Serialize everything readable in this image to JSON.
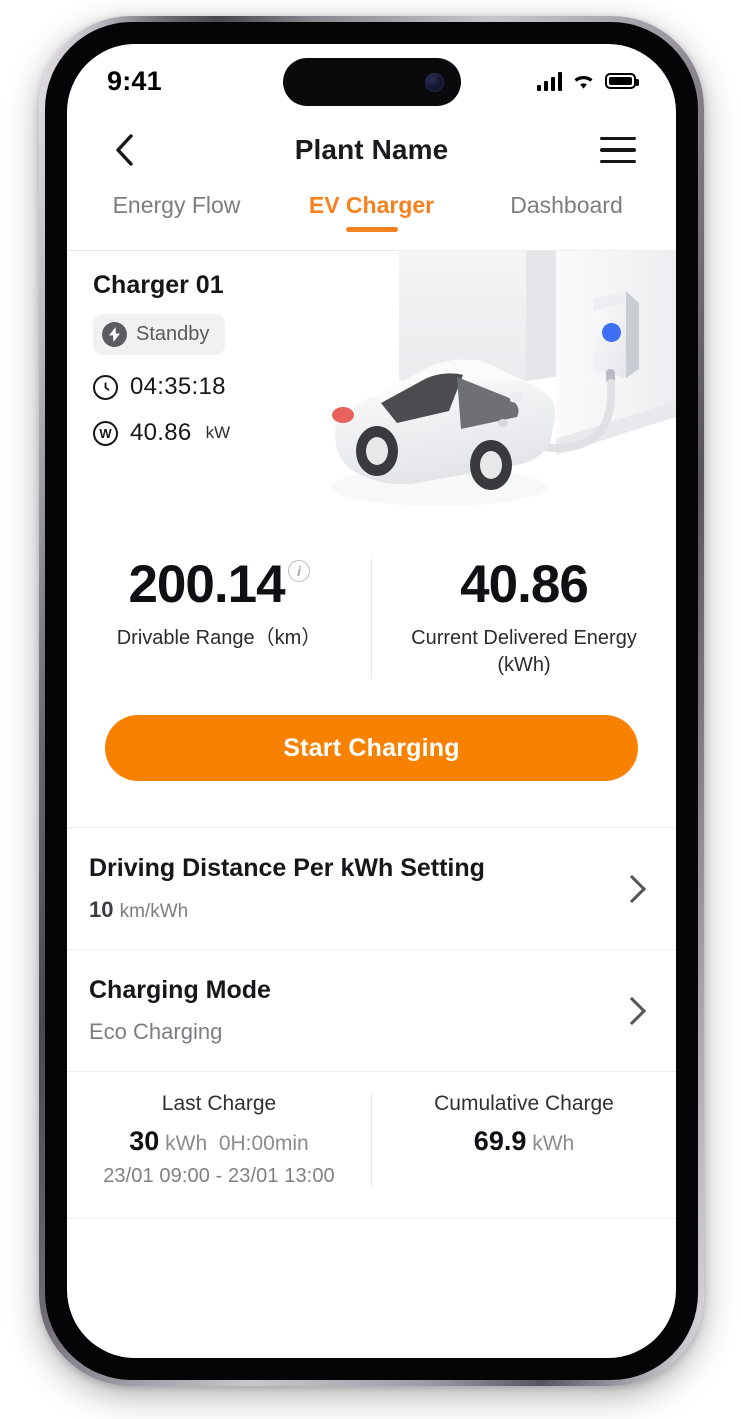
{
  "status_bar": {
    "time": "9:41",
    "signal_icon": "cellular-bars-icon",
    "wifi_icon": "wifi-icon",
    "battery_icon": "battery-full-icon"
  },
  "nav": {
    "back_icon": "chevron-left-icon",
    "title": "Plant Name",
    "menu_icon": "hamburger-menu-icon"
  },
  "tabs": [
    {
      "label": "Energy Flow",
      "active": false
    },
    {
      "label": "EV Charger",
      "active": true
    },
    {
      "label": "Dashboard",
      "active": false
    }
  ],
  "charger": {
    "name": "Charger 01",
    "status_badge": {
      "label": "Standby",
      "icon": "lightning-bolt-icon"
    },
    "duration": {
      "icon": "clock-icon",
      "value": "04:35:18"
    },
    "power": {
      "icon": "watt-icon",
      "icon_glyph": "W",
      "value": "40.86",
      "unit": "kW"
    },
    "illustration": "ev-car-charging-illustration"
  },
  "stats": [
    {
      "value": "200.14",
      "label": "Drivable Range（km）",
      "info_icon": "info-icon",
      "has_info": true
    },
    {
      "value": "40.86",
      "label": "Current Delivered Energy\n(kWh)",
      "has_info": false
    }
  ],
  "cta": {
    "label": "Start Charging"
  },
  "settings_rows": [
    {
      "title": "Driving Distance Per kWh Setting",
      "value": "10",
      "unit": "km/kWh",
      "chevron_icon": "chevron-right-icon"
    },
    {
      "title": "Charging Mode",
      "value": "Eco Charging",
      "unit": "",
      "chevron_icon": "chevron-right-icon"
    }
  ],
  "footer": {
    "last_charge": {
      "title": "Last Charge",
      "amount": "30",
      "amount_unit": "kWh",
      "duration": "0H:00min",
      "period": "23/01 09:00  -  23/01 13:00"
    },
    "cumulative_charge": {
      "title": "Cumulative Charge",
      "amount": "69.9",
      "amount_unit": "kWh"
    }
  },
  "colors": {
    "accent": "#F98100",
    "tab_active": "#F58220",
    "text_primary": "#17171b",
    "text_muted": "#7d7d84",
    "divider": "#ededef"
  }
}
